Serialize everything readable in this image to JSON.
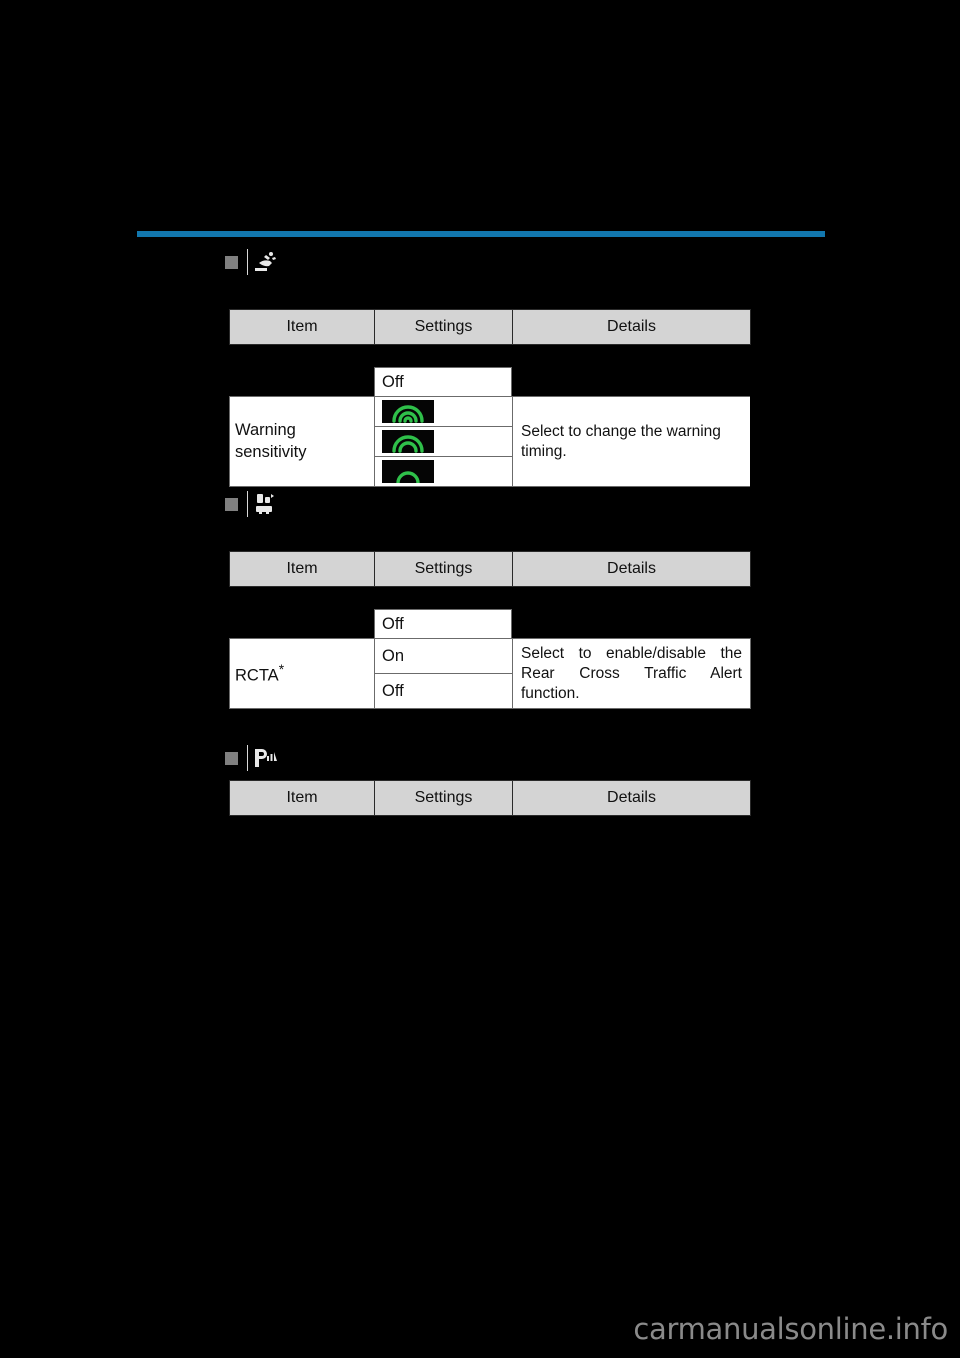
{
  "page": {
    "background_color": "#000000",
    "rule_color": "#1277ae",
    "watermark": "carmanualsonline.info"
  },
  "table_headers": {
    "item": "Item",
    "settings": "Settings",
    "details": "Details"
  },
  "sections": [
    {
      "id": "blind-spot-monitor",
      "icon_name": "blind-spot-monitor-icon",
      "floating_setting": "Off",
      "rows": [
        {
          "item": "Warning sensitivity",
          "settings": [
            "wave-3-arcs",
            "wave-2-arcs",
            "wave-1-arc"
          ],
          "details": "Select to change the warning timing."
        }
      ]
    },
    {
      "id": "rear-cross-traffic-alert",
      "icon_name": "rear-cross-traffic-alert-icon",
      "floating_setting": "Off",
      "rows": [
        {
          "item": "RCTA",
          "item_footnote": "*",
          "settings": [
            "On",
            "Off"
          ],
          "details": "Select to enable/disable the Rear Cross Traffic Alert function."
        }
      ]
    },
    {
      "id": "parking-assist",
      "icon_name": "parking-assist-icon",
      "rows": []
    }
  ]
}
